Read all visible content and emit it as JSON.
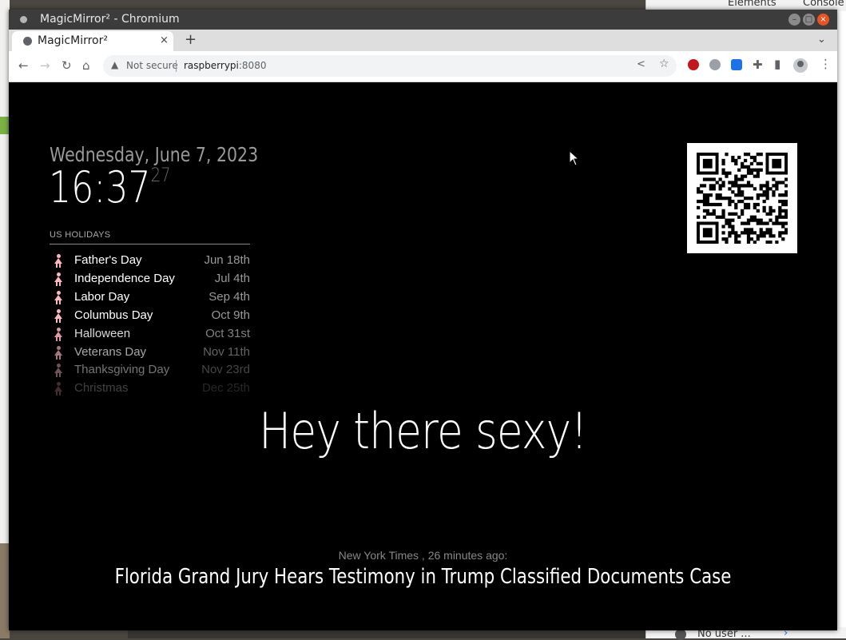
{
  "window": {
    "title": "MagicMirror² - Chromium"
  },
  "tab": {
    "title": "MagicMirror²",
    "close": "×"
  },
  "toolbar": {
    "new_tab": "+",
    "not_secure": "Not secure",
    "url_host": "raspberrypi",
    "url_port": ":8080"
  },
  "devtools": {
    "tab_elements": "Elements",
    "tab_console": "Console",
    "no_user": "No user ..."
  },
  "clock": {
    "date": "Wednesday, June 7, 2023",
    "time": "16:37",
    "seconds": "27"
  },
  "holidays": {
    "header": "US HOLIDAYS",
    "items": [
      {
        "name": "Father's Day",
        "date": "Jun 18th",
        "opacity": 1.0
      },
      {
        "name": "Independence Day",
        "date": "Jul 4th",
        "opacity": 1.0
      },
      {
        "name": "Labor Day",
        "date": "Sep 4th",
        "opacity": 1.0
      },
      {
        "name": "Columbus Day",
        "date": "Oct 9th",
        "opacity": 1.0
      },
      {
        "name": "Halloween",
        "date": "Oct 31st",
        "opacity": 0.85
      },
      {
        "name": "Veterans Day",
        "date": "Nov 11th",
        "opacity": 0.65
      },
      {
        "name": "Thanksgiving Day",
        "date": "Nov 23rd",
        "opacity": 0.45
      },
      {
        "name": "Christmas",
        "date": "Dec 25th",
        "opacity": 0.25
      }
    ]
  },
  "compliment": "Hey there sexy!",
  "news": {
    "source": "New York Times , 26 minutes ago:",
    "headline": "Florida Grand Jury Hears Testimony in Trump Classified Documents Case"
  },
  "colors": {
    "accent_close": "#e95420",
    "holiday_icon": "#ffb6c1"
  }
}
